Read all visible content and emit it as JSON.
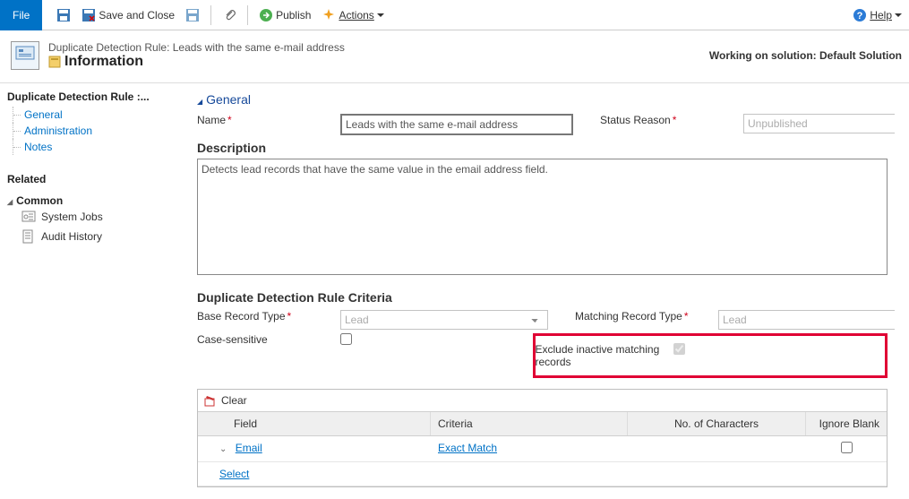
{
  "ribbon": {
    "file": "File",
    "save_and_close": "Save and Close",
    "publish": "Publish",
    "actions": "Actions",
    "help": "Help"
  },
  "header": {
    "crumb": "Duplicate Detection Rule: Leads with the same e-mail address",
    "title": "Information",
    "solution_label": "Working on solution: Default Solution"
  },
  "sidebar": {
    "breadcrumb": "Duplicate Detection Rule :...",
    "items": [
      {
        "label": "General"
      },
      {
        "label": "Administration"
      },
      {
        "label": "Notes"
      }
    ],
    "related_label": "Related",
    "common_label": "Common",
    "common_items": [
      {
        "label": "System Jobs"
      },
      {
        "label": "Audit History"
      }
    ]
  },
  "form": {
    "section_general": "General",
    "name_label": "Name",
    "name_value": "Leads with the same e-mail address",
    "status_label": "Status Reason",
    "status_value": "Unpublished",
    "description_label": "Description",
    "description_value": "Detects lead records that have the same value in the email address field.",
    "criteria_header": "Duplicate Detection Rule Criteria",
    "base_type_label": "Base Record Type",
    "base_type_value": "Lead",
    "match_type_label": "Matching Record Type",
    "match_type_value": "Lead",
    "case_label": "Case-sensitive",
    "exclude_label": "Exclude inactive matching records",
    "clear_label": "Clear",
    "col_field": "Field",
    "col_criteria": "Criteria",
    "col_chars": "No. of Characters",
    "col_ignore": "Ignore Blank",
    "rows": [
      {
        "field": "Email",
        "criteria": "Exact Match",
        "ignore": false
      },
      {
        "field": "Select",
        "criteria": "",
        "ignore": null
      }
    ]
  }
}
